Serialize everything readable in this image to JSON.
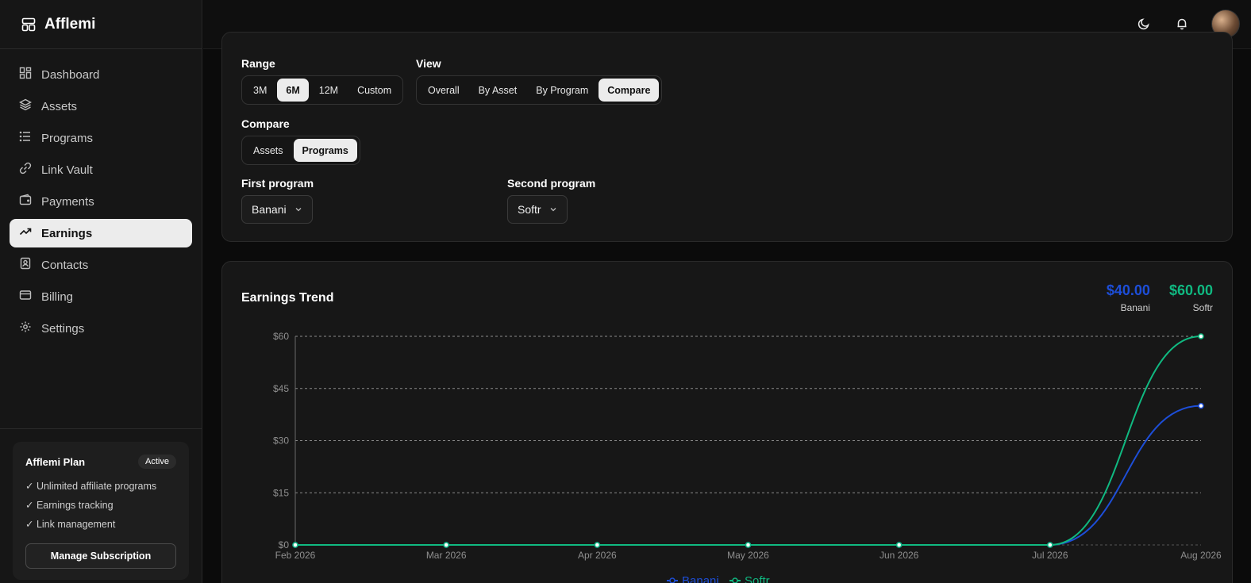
{
  "brand": {
    "name": "Afflemi"
  },
  "sidebar": {
    "items": [
      {
        "label": "Dashboard",
        "icon": "dashboard-icon"
      },
      {
        "label": "Assets",
        "icon": "layers-icon"
      },
      {
        "label": "Programs",
        "icon": "list-icon"
      },
      {
        "label": "Link Vault",
        "icon": "link-icon"
      },
      {
        "label": "Payments",
        "icon": "wallet-icon"
      },
      {
        "label": "Earnings",
        "icon": "trend-icon",
        "active": true
      },
      {
        "label": "Contacts",
        "icon": "contact-icon"
      },
      {
        "label": "Billing",
        "icon": "card-icon"
      },
      {
        "label": "Settings",
        "icon": "gear-icon"
      }
    ],
    "plan": {
      "title": "Afflemi Plan",
      "badge": "Active",
      "features": [
        "✓ Unlimited affiliate programs",
        "✓ Earnings tracking",
        "✓ Link management"
      ],
      "button": "Manage Subscription"
    }
  },
  "filters": {
    "range_label": "Range",
    "range_options": [
      "3M",
      "6M",
      "12M",
      "Custom"
    ],
    "range_selected": "6M",
    "view_label": "View",
    "view_options": [
      "Overall",
      "By Asset",
      "By Program",
      "Compare"
    ],
    "view_selected": "Compare",
    "compare_label": "Compare",
    "compare_options": [
      "Assets",
      "Programs"
    ],
    "compare_selected": "Programs",
    "first_label": "First program",
    "first_value": "Banani",
    "second_label": "Second program",
    "second_value": "Softr"
  },
  "chart_card": {
    "title": "Earnings Trend",
    "totals": [
      {
        "value": "$40.00",
        "name": "Banani",
        "color": "#1d4ed8"
      },
      {
        "value": "$60.00",
        "name": "Softr",
        "color": "#10b981"
      }
    ]
  },
  "chart_data": {
    "type": "line",
    "title": "Earnings Trend",
    "x": [
      "Feb 2026",
      "Mar 2026",
      "Apr 2026",
      "May 2026",
      "Jun 2026",
      "Jul 2026",
      "Aug 2026"
    ],
    "yticks": [
      "$0",
      "$15",
      "$30",
      "$45",
      "$60"
    ],
    "ylim": [
      0,
      60
    ],
    "grid": true,
    "legend": "bottom",
    "series": [
      {
        "name": "Banani",
        "values": [
          0,
          0,
          0,
          0,
          0,
          0,
          40
        ],
        "color": "#1d4ed8"
      },
      {
        "name": "Softr",
        "values": [
          0,
          0,
          0,
          0,
          0,
          0,
          60
        ],
        "color": "#10b981"
      }
    ]
  }
}
